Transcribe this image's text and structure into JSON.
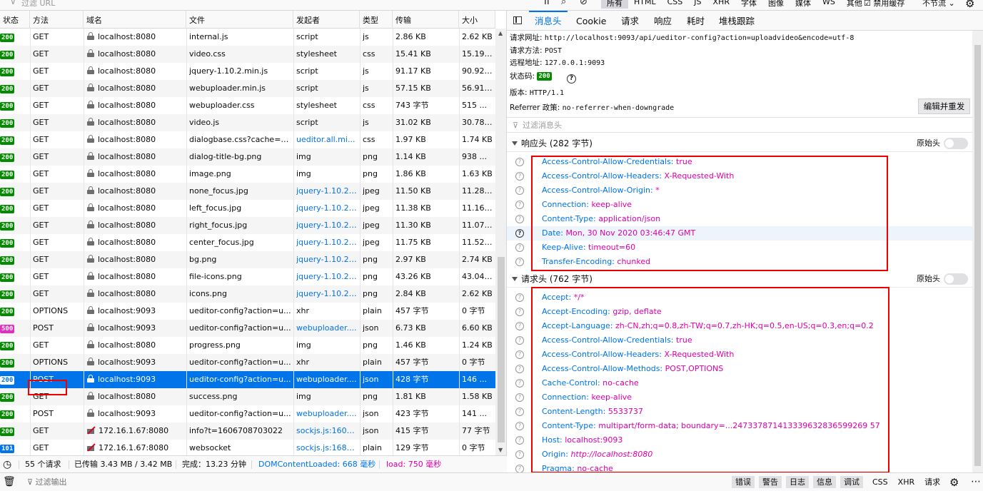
{
  "toolbar": {
    "filter_placeholder": "过滤 URL",
    "type_filters": [
      "所有",
      "HTML",
      "CSS",
      "JS",
      "XHR",
      "字体",
      "图像",
      "媒体",
      "WS",
      "其他"
    ],
    "disable_cache": "禁用缓存",
    "throttle": "不节流"
  },
  "table": {
    "columns": [
      "状态",
      "方法",
      "域名",
      "文件",
      "发起者",
      "类型",
      "传输",
      "大小"
    ],
    "rows": [
      {
        "status": "200",
        "method": "GET",
        "secure": true,
        "domain": "localhost:8080",
        "file": "internal.js",
        "initiator": "script",
        "initiator_link": false,
        "type": "js",
        "transferred": "2.86 KB",
        "size": "2.62 KB"
      },
      {
        "status": "200",
        "method": "GET",
        "secure": true,
        "domain": "localhost:8080",
        "file": "video.css",
        "initiator": "stylesheet",
        "initiator_link": false,
        "type": "css",
        "transferred": "15.41 KB",
        "size": "15.19 ..."
      },
      {
        "status": "200",
        "method": "GET",
        "secure": true,
        "domain": "localhost:8080",
        "file": "jquery-1.10.2.min.js",
        "initiator": "script",
        "initiator_link": false,
        "type": "js",
        "transferred": "91.17 KB",
        "size": "90.92 ..."
      },
      {
        "status": "200",
        "method": "GET",
        "secure": true,
        "domain": "localhost:8080",
        "file": "webuploader.min.js",
        "initiator": "script",
        "initiator_link": false,
        "type": "js",
        "transferred": "57.15 KB",
        "size": "56.91 ..."
      },
      {
        "status": "200",
        "method": "GET",
        "secure": true,
        "domain": "localhost:8080",
        "file": "webuploader.css",
        "initiator": "stylesheet",
        "initiator_link": false,
        "type": "css",
        "transferred": "743 字节",
        "size": "515 ..."
      },
      {
        "status": "200",
        "method": "GET",
        "secure": true,
        "domain": "localhost:8080",
        "file": "video.js",
        "initiator": "script",
        "initiator_link": false,
        "type": "js",
        "transferred": "31.02 KB",
        "size": "30.78 ..."
      },
      {
        "status": "200",
        "method": "GET",
        "secure": true,
        "domain": "localhost:8080",
        "file": "dialogbase.css?cache=0....",
        "initiator": "ueditor.all.mi...",
        "initiator_link": true,
        "type": "css",
        "transferred": "1.97 KB",
        "size": "1.74 KB"
      },
      {
        "status": "200",
        "method": "GET",
        "secure": true,
        "domain": "localhost:8080",
        "file": "dialog-title-bg.png",
        "initiator": "img",
        "initiator_link": false,
        "type": "png",
        "transferred": "1.14 KB",
        "size": "938 ..."
      },
      {
        "status": "200",
        "method": "GET",
        "secure": true,
        "domain": "localhost:8080",
        "file": "image.png",
        "initiator": "img",
        "initiator_link": false,
        "type": "png",
        "transferred": "1.86 KB",
        "size": "1.63 KB"
      },
      {
        "status": "200",
        "method": "GET",
        "secure": true,
        "domain": "localhost:8080",
        "file": "none_focus.jpg",
        "initiator": "jquery-1.10.2....",
        "initiator_link": true,
        "type": "jpeg",
        "transferred": "11.50 KB",
        "size": "11.28 ..."
      },
      {
        "status": "200",
        "method": "GET",
        "secure": true,
        "domain": "localhost:8080",
        "file": "left_focus.jpg",
        "initiator": "jquery-1.10.2....",
        "initiator_link": true,
        "type": "jpeg",
        "transferred": "11.38 KB",
        "size": "11.16 ..."
      },
      {
        "status": "200",
        "method": "GET",
        "secure": true,
        "domain": "localhost:8080",
        "file": "right_focus.jpg",
        "initiator": "jquery-1.10.2....",
        "initiator_link": true,
        "type": "jpeg",
        "transferred": "11.30 KB",
        "size": "11.07 ..."
      },
      {
        "status": "200",
        "method": "GET",
        "secure": true,
        "domain": "localhost:8080",
        "file": "center_focus.jpg",
        "initiator": "jquery-1.10.2....",
        "initiator_link": true,
        "type": "jpeg",
        "transferred": "11.75 KB",
        "size": "11.52 ..."
      },
      {
        "status": "200",
        "method": "GET",
        "secure": true,
        "domain": "localhost:8080",
        "file": "bg.png",
        "initiator": "jquery-1.10.2....",
        "initiator_link": true,
        "type": "png",
        "transferred": "2.97 KB",
        "size": "2.74 KB"
      },
      {
        "status": "200",
        "method": "GET",
        "secure": true,
        "domain": "localhost:8080",
        "file": "file-icons.png",
        "initiator": "jquery-1.10.2....",
        "initiator_link": true,
        "type": "png",
        "transferred": "43.26 KB",
        "size": "43.04 ..."
      },
      {
        "status": "200",
        "method": "GET",
        "secure": true,
        "domain": "localhost:8080",
        "file": "icons.png",
        "initiator": "jquery-1.10.2....",
        "initiator_link": true,
        "type": "png",
        "transferred": "2.84 KB",
        "size": "2.62 KB"
      },
      {
        "status": "200",
        "method": "OPTIONS",
        "secure": true,
        "domain": "localhost:9093",
        "file": "ueditor-config?action=u...",
        "initiator": "xhr",
        "initiator_link": false,
        "type": "plain",
        "transferred": "457 字节",
        "size": "0 字节"
      },
      {
        "status": "500",
        "method": "POST",
        "secure": true,
        "domain": "localhost:9093",
        "file": "ueditor-config?action=u...",
        "initiator": "webuploader....",
        "initiator_link": true,
        "type": "json",
        "transferred": "6.73 KB",
        "size": "6.60 KB"
      },
      {
        "status": "200",
        "method": "GET",
        "secure": true,
        "domain": "localhost:8080",
        "file": "progress.png",
        "initiator": "img",
        "initiator_link": false,
        "type": "png",
        "transferred": "1.46 KB",
        "size": "1.24 KB"
      },
      {
        "status": "200",
        "method": "OPTIONS",
        "secure": true,
        "domain": "localhost:9093",
        "file": "ueditor-config?action=u...",
        "initiator": "xhr",
        "initiator_link": false,
        "type": "plain",
        "transferred": "457 字节",
        "size": "0 字节"
      },
      {
        "status": "200",
        "method": "POST",
        "secure": true,
        "domain": "localhost:9093",
        "file": "ueditor-config?action=u...",
        "initiator": "webuploader....",
        "initiator_link": true,
        "type": "json",
        "transferred": "428 字节",
        "size": "146 ...",
        "selected": true
      },
      {
        "status": "200",
        "method": "GET",
        "secure": true,
        "domain": "localhost:8080",
        "file": "success.png",
        "initiator": "img",
        "initiator_link": false,
        "type": "png",
        "transferred": "1.81 KB",
        "size": "1.58 KB"
      },
      {
        "status": "200",
        "method": "POST",
        "secure": true,
        "domain": "localhost:9093",
        "file": "ueditor-config?action=u...",
        "initiator": "webuploader....",
        "initiator_link": true,
        "type": "json",
        "transferred": "423 字节",
        "size": "141 ..."
      },
      {
        "status": "200",
        "method": "GET",
        "secure": false,
        "domain": "172.16.1.67:8080",
        "file": "info?t=1606708703022",
        "initiator": "sockjs.js:1606 ...",
        "initiator_link": true,
        "type": "json",
        "transferred": "415 字节",
        "size": "77 字节"
      },
      {
        "status": "101",
        "method": "GET",
        "secure": false,
        "domain": "172.16.1.67:8080",
        "file": "websocket",
        "initiator": "sockjs.js:1684 ...",
        "initiator_link": true,
        "type": "plain",
        "transferred": "129 字节",
        "size": "0 字节"
      }
    ]
  },
  "statusbar": {
    "requests": "55 个请求",
    "transferred": "已传输 3.43 MB / 3.42 MB",
    "finish": "完成：13.23 分钟",
    "dom_loaded": "DOMContentLoaded: 668 毫秒",
    "load": "load: 750 毫秒"
  },
  "details": {
    "tabs": [
      "消息头",
      "Cookie",
      "请求",
      "响应",
      "耗时",
      "堆栈跟踪"
    ],
    "request_url_label": "请求网址:",
    "request_url": "http://localhost:9093/api/ueditor-config?action=uploadvideo&encode=utf-8",
    "method_label": "请求方法:",
    "method": "POST",
    "remote_label": "远程地址:",
    "remote": "127.0.0.1:9093",
    "status_label": "状态码:",
    "status": "200",
    "version_label": "版本:",
    "version": "HTTP/1.1",
    "referrer_label": "Referrer 政策:",
    "referrer": "no-referrer-when-downgrade",
    "edit_resend": "编辑并重发",
    "filter_placeholder": "过滤消息头",
    "raw_label": "原始头",
    "response_section": "响应头 (282 字节)",
    "response_headers": [
      {
        "name": "Access-Control-Allow-Credentials:",
        "value": "true"
      },
      {
        "name": "Access-Control-Allow-Headers:",
        "value": "X-Requested-With"
      },
      {
        "name": "Access-Control-Allow-Origin:",
        "value": "*"
      },
      {
        "name": "Connection:",
        "value": "keep-alive"
      },
      {
        "name": "Content-Type:",
        "value": "application/json"
      },
      {
        "name": "Date:",
        "value": "Mon, 30 Nov 2020 03:46:47 GMT",
        "highlight": true
      },
      {
        "name": "Keep-Alive:",
        "value": "timeout=60"
      },
      {
        "name": "Transfer-Encoding:",
        "value": "chunked"
      }
    ],
    "request_section": "请求头 (762 字节)",
    "request_headers": [
      {
        "name": "Accept:",
        "value": "*/*"
      },
      {
        "name": "Accept-Encoding:",
        "value": "gzip, deflate"
      },
      {
        "name": "Accept-Language:",
        "value": "zh-CN,zh;q=0.8,zh-TW;q=0.7,zh-HK;q=0.5,en-US;q=0.3,en;q=0.2"
      },
      {
        "name": "Access-Control-Allow-Credentials:",
        "value": "true"
      },
      {
        "name": "Access-Control-Allow-Headers:",
        "value": "X-Requested-With"
      },
      {
        "name": "Access-Control-Allow-Methods:",
        "value": "POST,OPTIONS"
      },
      {
        "name": "Cache-Control:",
        "value": "no-cache"
      },
      {
        "name": "Connection:",
        "value": "keep-alive"
      },
      {
        "name": "Content-Length:",
        "value": "5533737"
      },
      {
        "name": "Content-Type:",
        "value": "multipart/form-data; boundary=...247337871413339632836599269 57"
      },
      {
        "name": "Host:",
        "value": "localhost:9093"
      },
      {
        "name": "Origin:",
        "value": "http://localhost:8080",
        "italic": true
      },
      {
        "name": "Pragma:",
        "value": "no-cache"
      }
    ]
  },
  "console": {
    "filter_placeholder": "过滤输出",
    "levels": [
      "错误",
      "警告",
      "日志",
      "信息",
      "调试"
    ],
    "extras": [
      "CSS",
      "XHR",
      "请求"
    ]
  },
  "colors": {
    "accent": "#0074e8",
    "status_ok": "#058b00",
    "status_error": "#e42dbf",
    "header_value": "#dd00a9",
    "highlight_box": "#ee0000"
  }
}
